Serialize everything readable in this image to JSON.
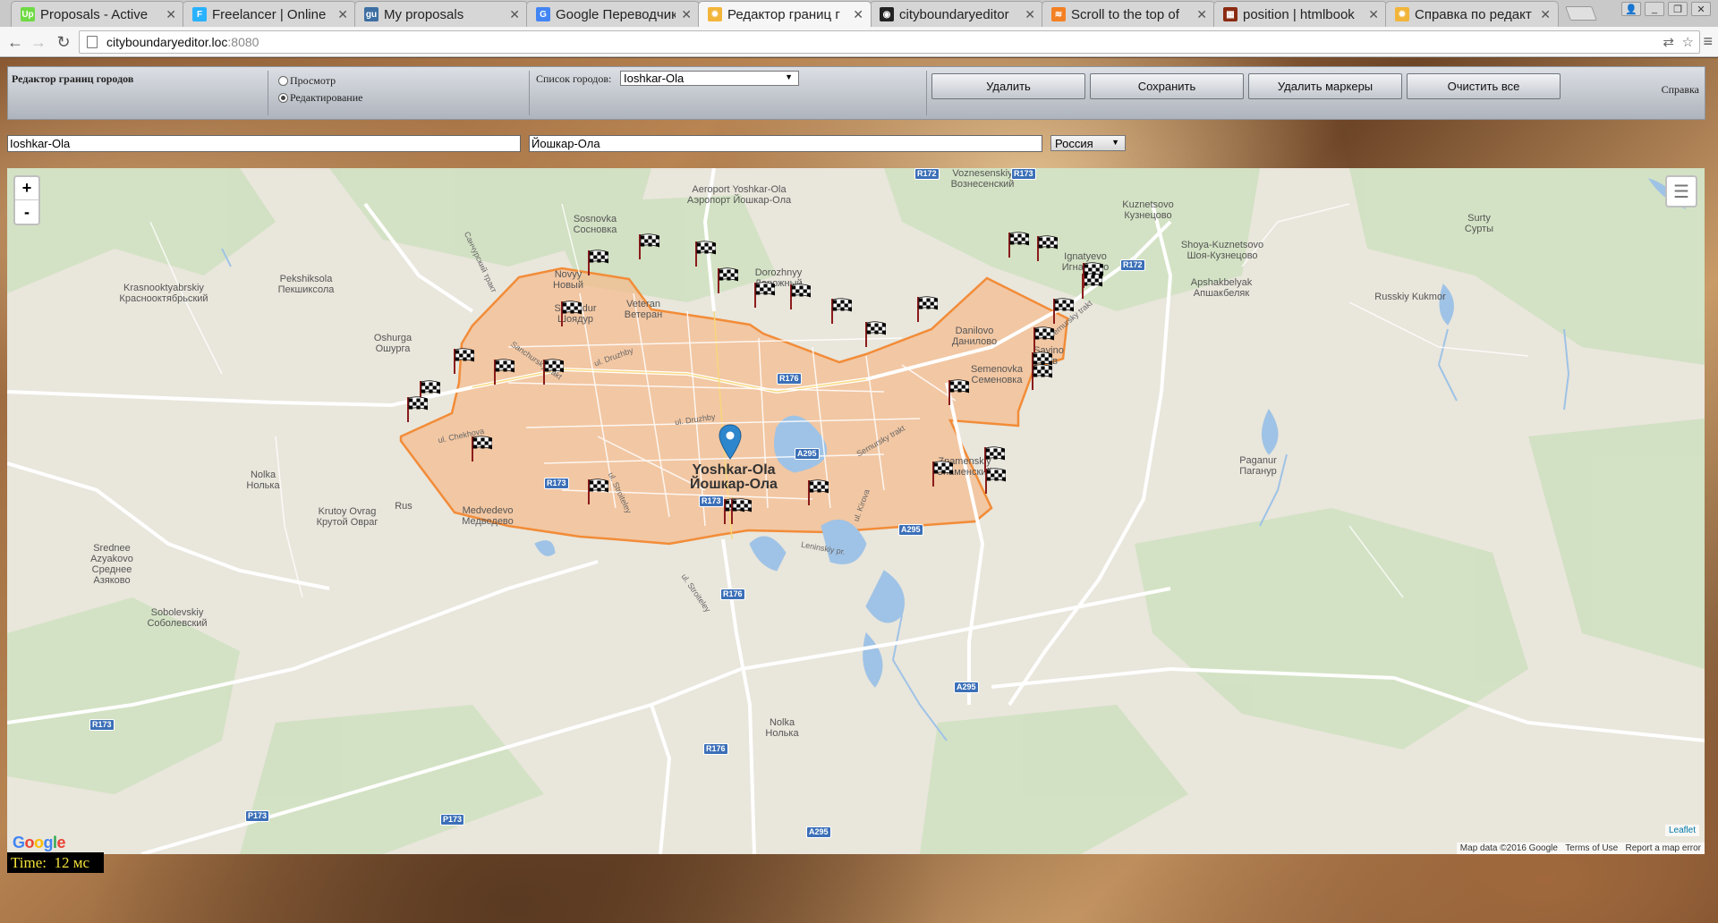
{
  "browser": {
    "tabs": [
      {
        "label": "Proposals - Active",
        "icon": "upwork-icon",
        "color": "#6fda44",
        "glyph": "Up"
      },
      {
        "label": "Freelancer | Online",
        "icon": "freelancer-icon",
        "color": "#29b2fe",
        "glyph": "F"
      },
      {
        "label": "My proposals",
        "icon": "guru-icon",
        "color": "#3d6fa3",
        "glyph": "gu"
      },
      {
        "label": "Google Переводчик",
        "icon": "translate-icon",
        "color": "#4285f4",
        "glyph": "G"
      },
      {
        "label": "Редактор границ г",
        "icon": "loading-icon",
        "color": "#f2b53a",
        "glyph": "✹"
      },
      {
        "label": "cityboundaryeditor",
        "icon": "github-icon",
        "color": "#222222",
        "glyph": "◉"
      },
      {
        "label": "Scroll to the top of",
        "icon": "stackoverflow-icon",
        "color": "#f48024",
        "glyph": "≋"
      },
      {
        "label": "position | htmlbook",
        "icon": "htmlbook-icon",
        "color": "#8b2b12",
        "glyph": "▦"
      },
      {
        "label": "Справка по редакт",
        "icon": "loading-icon",
        "color": "#f2b53a",
        "glyph": "✹"
      }
    ],
    "address": {
      "host": "cityboundaryeditor.loc",
      "port": ":8080"
    }
  },
  "app": {
    "title": "Редактор границ городов",
    "mode_view": "Просмотр",
    "mode_edit": "Редактирование",
    "city_list_label": "Список городов:",
    "city_selected": "Ioshkar-Ola",
    "buttons": {
      "delete": "Удалить",
      "save": "Сохранить",
      "delete_markers": "Удалить маркеры",
      "clear_all": "Очистить все"
    },
    "help": "Справка",
    "name_latin": "Ioshkar-Ola",
    "name_local": "Йошкар-Ола",
    "country": "Россия",
    "time_label": "Time:",
    "time_value": "12 мс"
  },
  "map": {
    "city_name_latin": "Yoshkar-Ola",
    "city_name_local": "Йошкар-Ола",
    "zoom_in": "+",
    "zoom_out": "-",
    "attribution_leaflet": "Leaflet",
    "attribution_data": "Map data ©2016 Google",
    "terms": "Terms of Use",
    "report": "Report a map error",
    "google_logo": "Google",
    "colors": {
      "boundary_fill": "#f5b98a",
      "boundary_stroke": "#f28c38",
      "water": "#9fc3e6",
      "forest": "#c5ddb3"
    },
    "places": [
      {
        "a": "Aeroport Yoshkar-Ola",
        "b": "Аэропорт Йошкар-Ола"
      },
      {
        "a": "Sosnovka",
        "b": "Сосновка"
      },
      {
        "a": "Kuznetsovo",
        "b": "Кузнецово"
      },
      {
        "a": "Surty",
        "b": "Сурты"
      },
      {
        "a": "Ignatyevo",
        "b": "Игнатьево"
      },
      {
        "a": "Shoya-Kuznetsovo",
        "b": "Шоя-Кузнецово"
      },
      {
        "a": "Krasnooktyabrskiy",
        "b": "Красноoктябрьский"
      },
      {
        "a": "Pekshiksola",
        "b": "Пекшиксола"
      },
      {
        "a": "Novyy",
        "b": "Новый"
      },
      {
        "a": "Dorozhnyy",
        "b": "Дорожный"
      },
      {
        "a": "Apshakbelyak",
        "b": "Апшакбеляк"
      },
      {
        "a": "Shoyadur",
        "b": "Шоядур"
      },
      {
        "a": "Veteran",
        "b": "Ветеран"
      },
      {
        "a": "Russkiy Kukmor",
        "b": "Русский Кукмор"
      },
      {
        "a": "Oshurga",
        "b": "Ошурга"
      },
      {
        "a": "Danilovo",
        "b": "Данилово"
      },
      {
        "a": "Savino",
        "b": "Сав"
      },
      {
        "a": "Semenovka",
        "b": "Семеновка"
      },
      {
        "a": "Paganur",
        "b": "Паганур"
      },
      {
        "a": "Nolka",
        "b": "Нолька"
      },
      {
        "a": "Znamenskiy",
        "b": "Знаменский"
      },
      {
        "a": "Krutoy Ovrag",
        "b": "Крутой Овраг"
      },
      {
        "a": "Medvedevo",
        "b": "Медведево"
      },
      {
        "a": "Rus",
        "b": ""
      },
      {
        "a": "Srednee Azyakovo",
        "b": "Среднее Азяково"
      },
      {
        "a": "Sobolevskiy",
        "b": "Соболевский"
      },
      {
        "a": "Voznesenskiy",
        "b": "Вознесенский"
      },
      {
        "a": "Nolka",
        "b": "Нолька"
      }
    ],
    "shields": [
      "R176",
      "A295",
      "R173",
      "R173",
      "R176",
      "A295",
      "R172",
      "R172",
      "A295",
      "R176",
      "R173",
      "P173",
      "P173",
      "A295",
      "R173"
    ],
    "road_names": [
      "ul. Druzhby",
      "ul. Druzhby",
      "ul. Chekhova",
      "ul. Stroiteley",
      "ul. Stroiteley",
      "ul. Kirova",
      "Leninskiy pr.",
      "Sernursky trakt",
      "Sanchursky trakt",
      "Санчурский тракт",
      "Sernursky trakt"
    ]
  }
}
